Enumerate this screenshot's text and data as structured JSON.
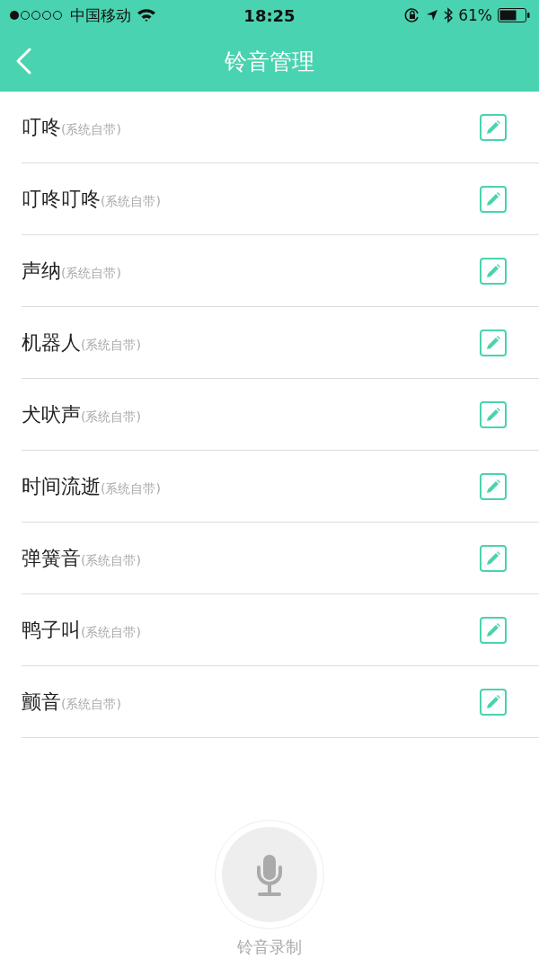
{
  "status_bar": {
    "carrier": "中国移动",
    "time": "18:25",
    "battery": "61%"
  },
  "nav": {
    "title": "铃音管理"
  },
  "ringtones": [
    {
      "name": "叮咚",
      "note": "(系统自带)"
    },
    {
      "name": "叮咚叮咚",
      "note": "(系统自带)"
    },
    {
      "name": "声纳",
      "note": "(系统自带)"
    },
    {
      "name": "机器人",
      "note": "(系统自带)"
    },
    {
      "name": "犬吠声",
      "note": "(系统自带)"
    },
    {
      "name": "时间流逝",
      "note": "(系统自带)"
    },
    {
      "name": "弹簧音",
      "note": "(系统自带)"
    },
    {
      "name": "鸭子叫",
      "note": "(系统自带)"
    },
    {
      "name": "颤音",
      "note": "(系统自带)"
    }
  ],
  "record": {
    "label": "铃音录制"
  }
}
